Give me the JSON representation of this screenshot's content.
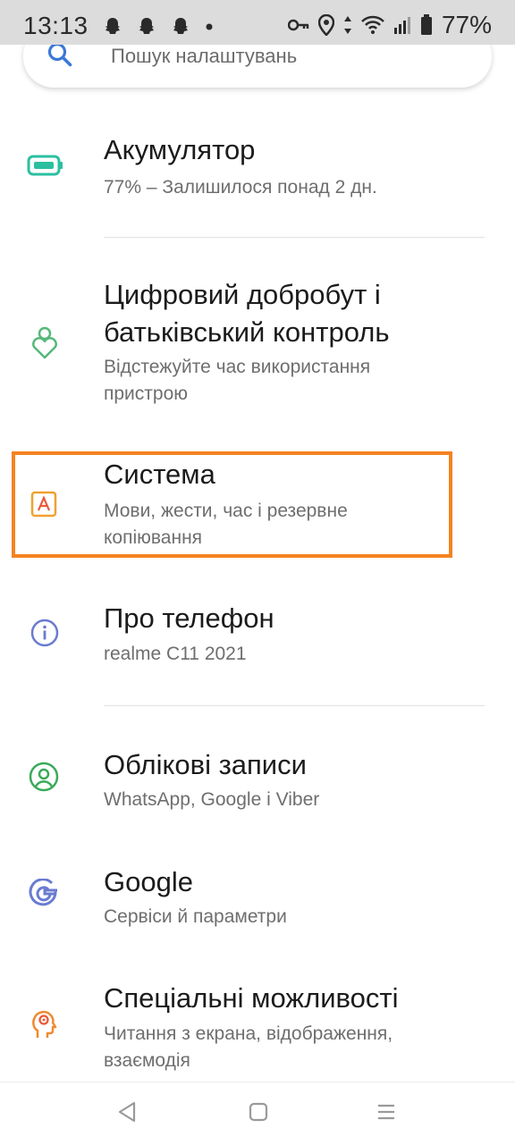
{
  "status_bar": {
    "time": "13:13",
    "battery_percent": "77%"
  },
  "search": {
    "placeholder": "Пошук налаштувань"
  },
  "settings_items": [
    {
      "title": "Акумулятор",
      "subtitle": "77% – Залишилося понад 2 дн.",
      "icon": "battery-icon"
    },
    {
      "title_lines": [
        "Цифровий добробут і",
        "батьківський контроль"
      ],
      "subtitle_lines": [
        "Відстежуйте час використання",
        "пристрою"
      ],
      "icon": "wellbeing-icon"
    },
    {
      "title": "Система",
      "subtitle_lines": [
        "Мови, жести, час і резервне",
        "копіювання"
      ],
      "icon": "system-icon"
    },
    {
      "title": "Про телефон",
      "subtitle": "realme C11 2021",
      "icon": "info-icon"
    },
    {
      "title": "Облікові записи",
      "subtitle": "WhatsApp, Google і Viber",
      "icon": "accounts-icon"
    },
    {
      "title": "Google",
      "subtitle": "Сервіси й параметри",
      "icon": "google-icon"
    },
    {
      "title": "Спеціальні можливості",
      "subtitle_lines": [
        "Читання з екрана, відображення,",
        "взаємодія"
      ],
      "icon": "accessibility-icon"
    }
  ],
  "colors": {
    "highlight": "#f58320",
    "battery_icon": "#2bbfa0",
    "wellbeing_icon": "#55b87a",
    "system_icon": "#f0a030",
    "info_icon": "#6a7bd0",
    "accounts_icon": "#3aaa5a",
    "google_icon": "#6a7bd0",
    "accessibility_icon": "#f08a30"
  }
}
